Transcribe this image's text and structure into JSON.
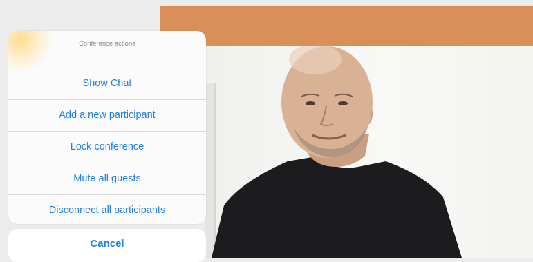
{
  "action_sheet": {
    "title": "Conference actions",
    "actions": [
      {
        "label": "Show Chat"
      },
      {
        "label": "Add a new participant"
      },
      {
        "label": "Lock conference"
      },
      {
        "label": "Mute all guests"
      },
      {
        "label": "Disconnect all participants"
      }
    ],
    "cancel_label": "Cancel"
  },
  "colors": {
    "accent": "#1f7ee5",
    "banner": "#d98f58",
    "sheet_background": "#fbfbfc"
  }
}
